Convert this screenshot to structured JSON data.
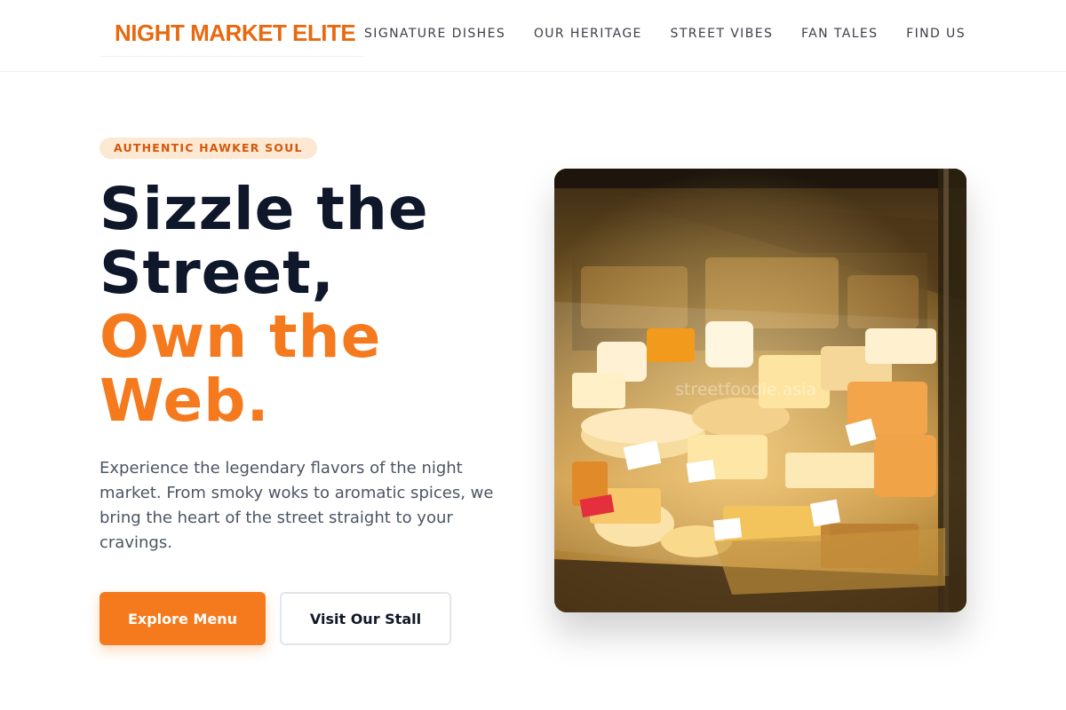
{
  "header": {
    "logo": "NIGHT MARKET ELITE",
    "nav": [
      "SIGNATURE DISHES",
      "OUR HERITAGE",
      "STREET VIBES",
      "FAN TALES",
      "FIND US"
    ]
  },
  "hero": {
    "badge": "AUTHENTIC HAWKER SOUL",
    "headline_dark": [
      "Sizzle the",
      "Street,"
    ],
    "headline_accent": [
      "Own the",
      "Web."
    ],
    "description": "Experience the legendary flavors of the night market. From smoky woks to aromatic spices, we bring the heart of the street straight to your cravings.",
    "primary_button": "Explore Menu",
    "secondary_button": "Visit Our Stall",
    "image": {
      "subject": "glass display case of cheeses",
      "watermark": "streetfoodie.asia"
    }
  },
  "colors": {
    "brand_orange": "#f47a1d",
    "logo_orange": "#e8690f",
    "badge_bg": "#fde9d3",
    "headline_dark": "#0f172a",
    "body_text": "#4b5563"
  }
}
